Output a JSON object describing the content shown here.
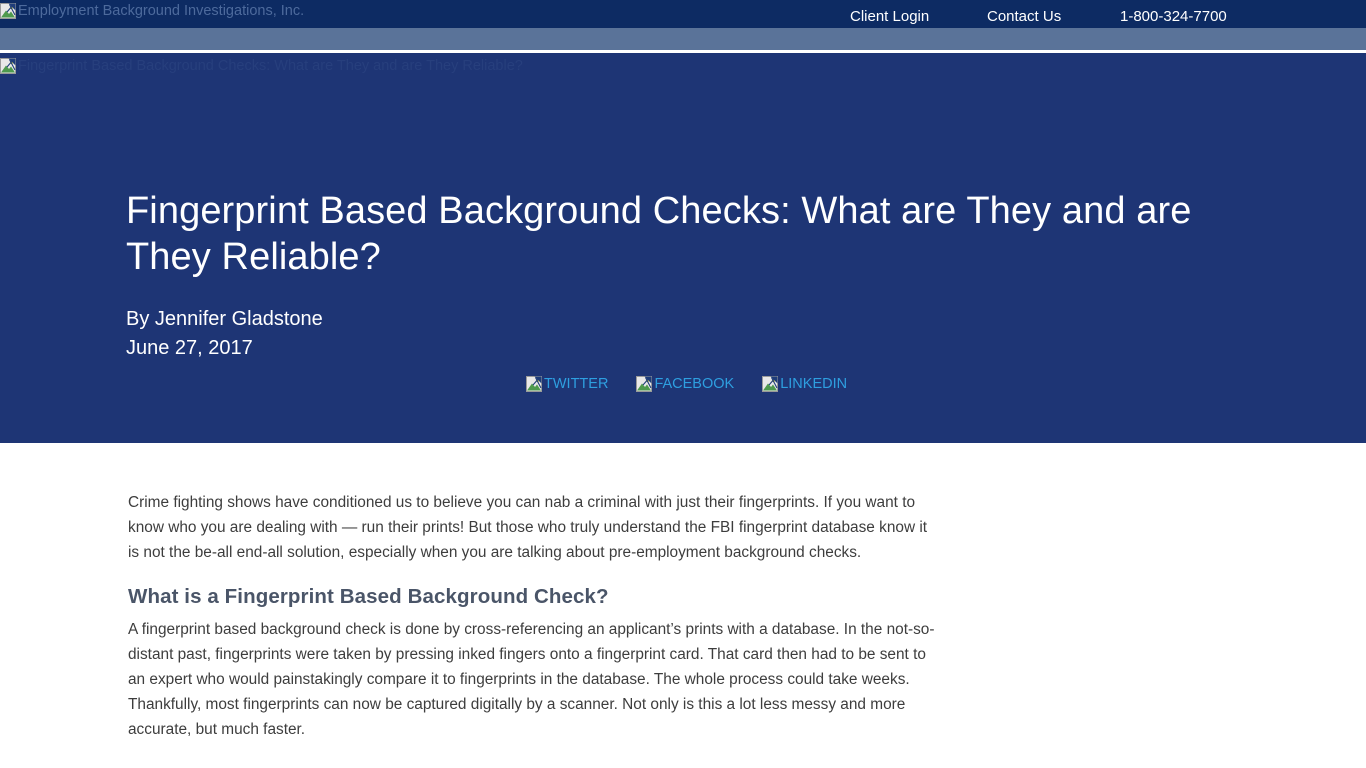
{
  "header": {
    "logo_alt": "Employment Background Investigations, Inc.",
    "nav": [
      {
        "label": "Client Login"
      },
      {
        "label": "Contact Us"
      },
      {
        "label": "1-800-324-7700"
      }
    ]
  },
  "hero": {
    "image_alt": "Fingerprint Based Background Checks: What are They and are They Reliable?",
    "title": "Fingerprint Based Background Checks: What are They and are They Reliable?",
    "byline": "By Jennifer Gladstone",
    "date": "June 27, 2017",
    "share": [
      {
        "label": "TWITTER"
      },
      {
        "label": "FACEBOOK"
      },
      {
        "label": "LINKEDIN"
      }
    ]
  },
  "article": {
    "paragraph_1": "Crime fighting shows have conditioned us to believe you can nab a criminal with just their fingerprints. If you want to know who you are dealing with — run their prints! But those who truly understand the FBI fingerprint database know it is not the be-all end-all solution, especially when you are talking about pre-employment background checks.",
    "heading_1": "What is a Fingerprint Based Background Check?",
    "paragraph_2": "A fingerprint based background check is done by cross-referencing an applicant’s prints with a database. In the not-so-distant past, fingerprints were taken by pressing inked fingers onto a fingerprint card. That card then had to be sent to an expert who would painstakingly compare it to fingerprints in the database. The whole process could take weeks. Thankfully, most fingerprints can now be captured digitally by a scanner. Not only is this a lot less messy and more accurate, but much faster."
  },
  "colors": {
    "topbar_navy": "#0d2b63",
    "subband_slate": "#5a7399",
    "hero_navy": "#1e3575",
    "link_blue": "#2e9fe0",
    "heading_slate": "#4a5568",
    "body_text": "#3d3d3d"
  }
}
